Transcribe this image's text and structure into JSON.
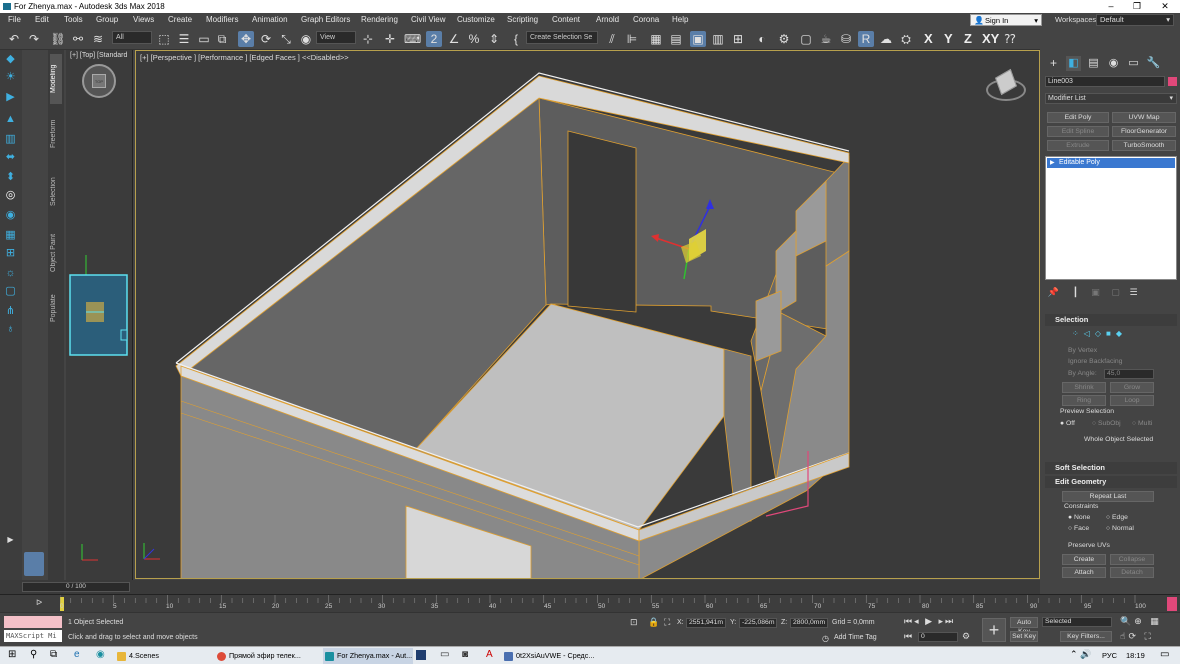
{
  "window": {
    "title": "For Zhenya.max - Autodesk 3ds Max 2018",
    "controls": [
      "–",
      "❐",
      "✕"
    ]
  },
  "menu": [
    "File",
    "Edit",
    "Tools",
    "Group",
    "Views",
    "Create",
    "Modifiers",
    "Animation",
    "Graph Editors",
    "Rendering",
    "Civil View",
    "Customize",
    "Scripting",
    "Content",
    "Arnold",
    "Corona",
    "Help"
  ],
  "account": {
    "sign_in": "Sign In",
    "workspaces_label": "Workspaces:",
    "workspace": "Default"
  },
  "toolbar": {
    "filter": "All",
    "ref_coord": "View",
    "selection_set": "Create Selection Se",
    "axes": [
      "X",
      "Y",
      "Z",
      "XY"
    ]
  },
  "ribbon_tabs": [
    "Modeling",
    "Freeform",
    "Selection",
    "Object Paint",
    "Populate"
  ],
  "small_viewport": {
    "label": "[+] [Top] [Standard",
    "cube_label": "TOP"
  },
  "viewport": {
    "label": "[+] [Perspective ] [Performance ] [Edged Faces ]  <<Disabled>>",
    "active_border": "#b7a04d",
    "wire_color": "#e0a030",
    "background": "#3a3a3a"
  },
  "command_panel": {
    "object_name": "Line003",
    "object_color": "#e0487a",
    "modifier_list": "Modifier List",
    "modifier_buttons": [
      {
        "label": "Edit Poly",
        "enabled": true
      },
      {
        "label": "UVW Map",
        "enabled": true
      },
      {
        "label": "Edit Spline",
        "enabled": false
      },
      {
        "label": "FloorGenerator",
        "enabled": true
      },
      {
        "label": "Extrude",
        "enabled": false
      },
      {
        "label": "TurboSmooth",
        "enabled": true
      }
    ],
    "stack": [
      "Editable Poly"
    ],
    "selection": {
      "title": "Selection",
      "by_vertex": "By Vertex",
      "ignore_backfacing": "Ignore Backfacing",
      "by_angle": "By Angle:",
      "by_angle_value": "45,0",
      "shrink": "Shrink",
      "grow": "Grow",
      "ring": "Ring",
      "loop": "Loop",
      "preview_title": "Preview Selection",
      "preview_off": "Off",
      "preview_subobj": "SubObj",
      "preview_multi": "Multi",
      "whole_object": "Whole Object Selected"
    },
    "soft_selection": "Soft Selection",
    "edit_geometry": {
      "title": "Edit Geometry",
      "repeat_last": "Repeat Last",
      "constraints": "Constraints",
      "none": "None",
      "edge": "Edge",
      "face": "Face",
      "normal": "Normal",
      "preserve_uvs": "Preserve UVs",
      "create": "Create",
      "collapse": "Collapse",
      "attach": "Attach",
      "detach": "Detach"
    }
  },
  "time": {
    "slider": "0 / 100",
    "ticks": [
      "0",
      "5",
      "10",
      "15",
      "20",
      "25",
      "30",
      "35",
      "40",
      "45",
      "50",
      "55",
      "60",
      "65",
      "70",
      "75",
      "80",
      "85",
      "90",
      "95",
      "100"
    ]
  },
  "status": {
    "maxscript": "MAXScript Mi",
    "objects": "1 Object Selected",
    "prompt": "Click and drag to select and move objects",
    "x_label": "X:",
    "x_value": "2551,941m",
    "y_label": "Y:",
    "y_value": "-225,086m",
    "z_label": "Z:",
    "z_value": "2800,0mm",
    "grid": "Grid = 0,0mm",
    "add_time_tag": "Add Time Tag",
    "auto_key": "Auto Key",
    "set_key": "Set Key",
    "key_mode": "Selected",
    "key_filters": "Key Filters...",
    "frame": "0"
  },
  "taskbar": {
    "items": [
      {
        "label": "4.Scenes",
        "color": "#e8b63a"
      },
      {
        "label": "Прямой эфир телек...",
        "color": "#dd4b39"
      },
      {
        "label": "For Zhenya.max - Aut...",
        "color": "#1a8fa0"
      },
      {
        "label": "0t2XsiAuVWE - Средс...",
        "color": "#4a6fb0"
      }
    ],
    "lang": "РУС",
    "clock": "18:19"
  }
}
